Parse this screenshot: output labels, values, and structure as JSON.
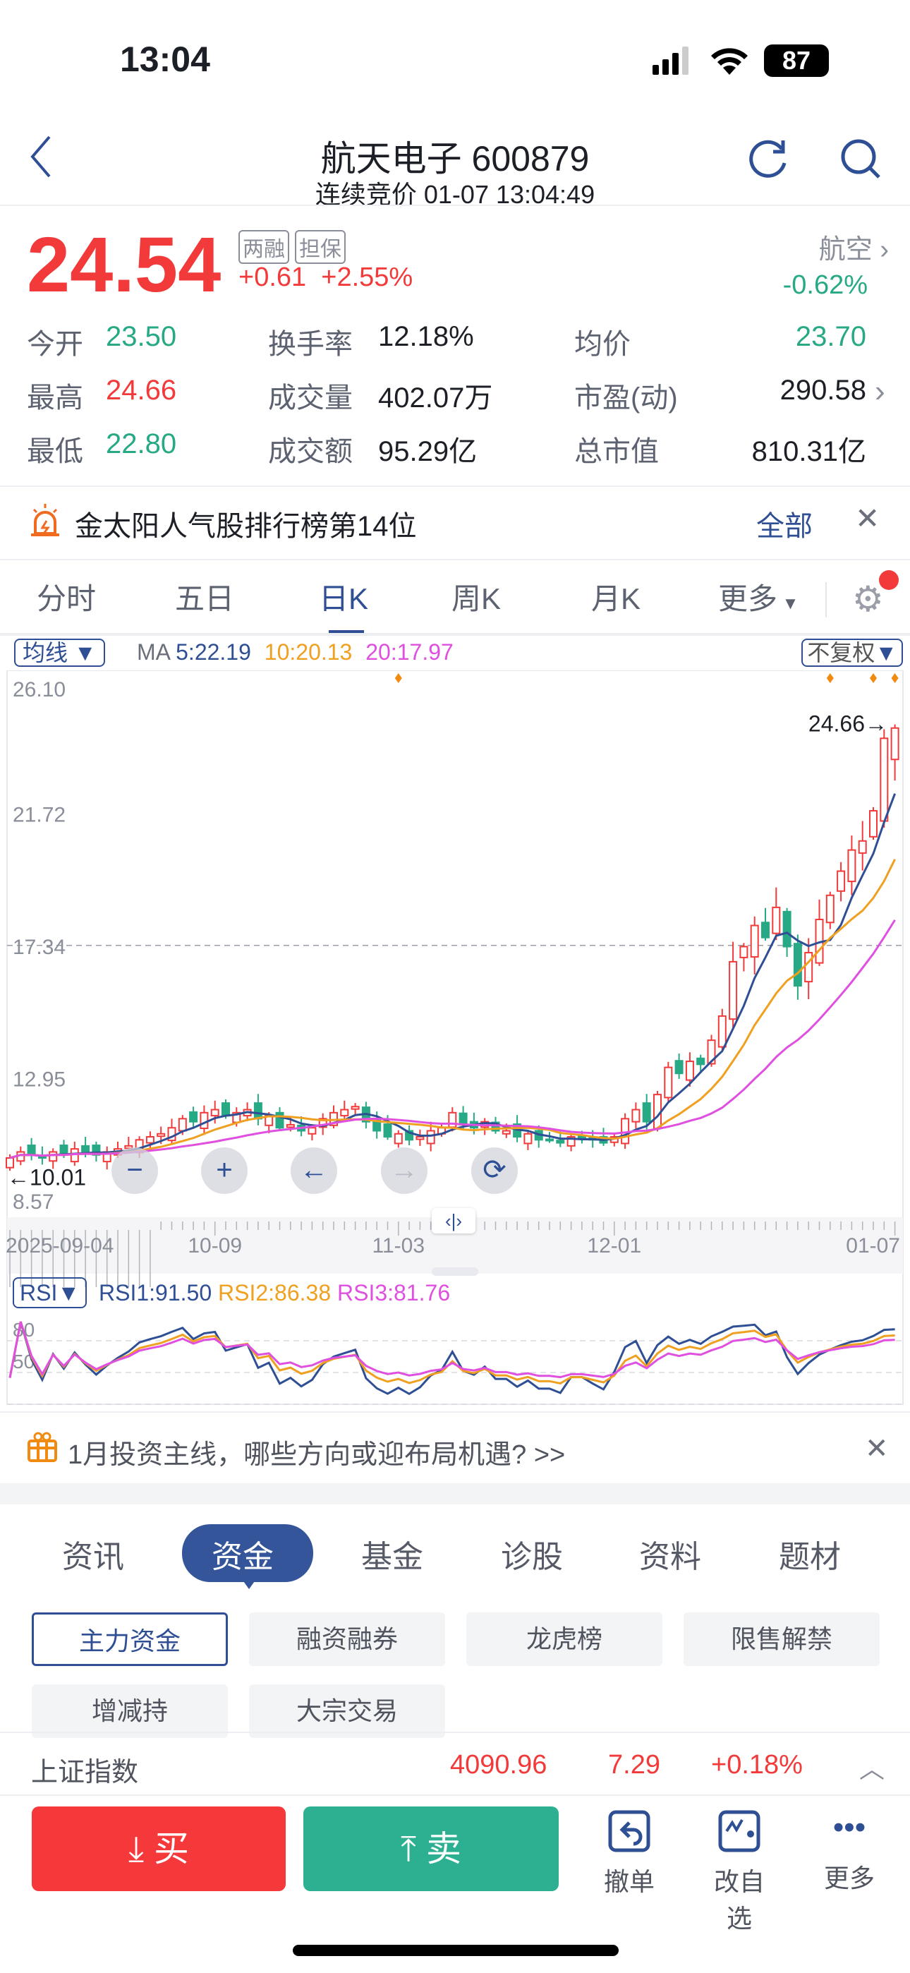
{
  "status": {
    "time": "13:04",
    "battery": "87"
  },
  "header": {
    "title": "航天电子 600879",
    "subtitle": "连续竞价 01-07 13:04:49"
  },
  "quote": {
    "price": "24.54",
    "change": "+0.61",
    "change_pct": "+2.55%",
    "tags": [
      "两融",
      "担保"
    ],
    "sector": "航空",
    "sector_pct": "-0.62%"
  },
  "stats": [
    [
      {
        "label": "今开",
        "value": "23.50",
        "color": "green"
      },
      {
        "label": "换手率",
        "value": "12.18%"
      },
      {
        "label": "均价",
        "value": "23.70",
        "color": "green"
      }
    ],
    [
      {
        "label": "最高",
        "value": "24.66",
        "color": "red"
      },
      {
        "label": "成交量",
        "value": "402.07万"
      },
      {
        "label": "市盈(动)",
        "value": "290.58"
      }
    ],
    [
      {
        "label": "最低",
        "value": "22.80",
        "color": "green"
      },
      {
        "label": "成交额",
        "value": "95.29亿"
      },
      {
        "label": "总市值",
        "value": "810.31亿"
      }
    ]
  ],
  "notice": {
    "text": "金太阳人气股排行榜第14位",
    "all": "全部"
  },
  "tabs": [
    "分时",
    "五日",
    "日K",
    "周K",
    "月K",
    "更多"
  ],
  "chart_data": {
    "type": "candlestick",
    "ma_label": "均线",
    "ma_title": "MA",
    "ma5": "5:22.19",
    "ma10": "10:20.13",
    "ma20": "20:17.97",
    "adjust": "不复权",
    "y_ticks": [
      "26.10",
      "21.72",
      "17.34",
      "12.95",
      "8.57"
    ],
    "ylim": [
      8.57,
      26.1
    ],
    "x_ticks": [
      "2025-09-04",
      "10-09",
      "11-03",
      "12-01",
      "01-07"
    ],
    "max_label": "24.66→",
    "min_label": "←10.01",
    "closes": [
      10.3,
      10.5,
      10.4,
      10.3,
      10.5,
      10.4,
      10.6,
      10.5,
      10.4,
      10.5,
      10.6,
      10.7,
      10.9,
      11.0,
      11.1,
      11.3,
      11.6,
      11.5,
      11.8,
      11.9,
      11.7,
      11.8,
      11.9,
      11.6,
      11.7,
      11.3,
      11.4,
      11.2,
      11.3,
      11.6,
      11.8,
      11.9,
      12.0,
      11.5,
      11.2,
      11.0,
      11.1,
      10.9,
      11.0,
      11.2,
      11.3,
      11.8,
      11.4,
      11.3,
      11.5,
      11.2,
      11.2,
      11.0,
      11.1,
      10.9,
      10.9,
      10.8,
      11.0,
      11.0,
      10.9,
      10.8,
      11.0,
      11.6,
      11.9,
      11.5,
      12.4,
      13.3,
      13.1,
      13.5,
      13.4,
      14.2,
      15.0,
      16.8,
      17.3,
      18.0,
      17.6,
      18.6,
      17.3,
      16.0,
      17.1,
      18.2,
      19.0,
      19.8,
      20.5,
      20.8,
      21.8,
      24.2,
      24.54
    ],
    "rsi_label": "RSI",
    "rsi1": "RSI1:91.50",
    "rsi2": "RSI2:86.38",
    "rsi3": "RSI3:81.76",
    "rsi_ticks": [
      "80",
      "50"
    ],
    "colors": {
      "up": "#f23a3a",
      "down": "#27a986",
      "ma5": "#2f4f95",
      "ma10": "#f0a020",
      "ma20": "#e050e0"
    }
  },
  "promo": {
    "text": "1月投资主线，哪些方向或迎布局机遇? >>"
  },
  "bottom_tabs": [
    "资讯",
    "资金",
    "基金",
    "诊股",
    "资料",
    "题材"
  ],
  "chips": [
    "主力资金",
    "融资融券",
    "龙虎榜",
    "限售解禁",
    "增减持",
    "大宗交易"
  ],
  "index": {
    "name": "上证指数",
    "value": "4090.96",
    "change": "7.29",
    "pct": "+0.18%"
  },
  "actions": {
    "buy": "买",
    "sell": "卖",
    "cancel": "撤单",
    "watch": "改自选",
    "more": "更多"
  }
}
